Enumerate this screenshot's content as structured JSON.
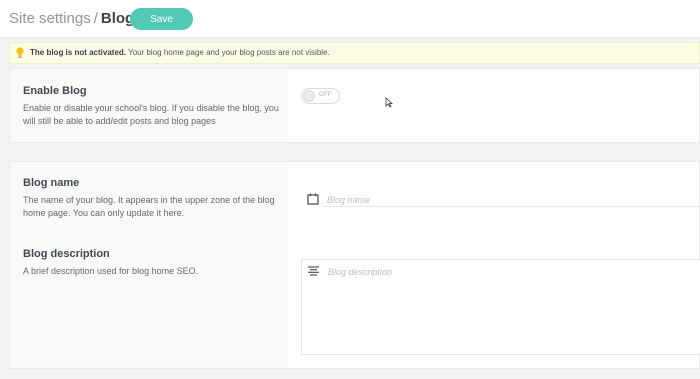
{
  "header": {
    "breadcrumb_parent": "Site settings",
    "separator": "/",
    "breadcrumb_current": "Blog",
    "save_label": "Save"
  },
  "alert": {
    "strong_text": "The blog is not activated.",
    "text": " Your blog home page and your blog posts are not visible.",
    "icon": "lightbulb-icon"
  },
  "enable_blog": {
    "title": "Enable Blog",
    "description": "Enable or disable your school's blog. If you disable the blog, you will still be able to add/edit posts and blog pages",
    "toggle_state": "OFF",
    "enabled": false
  },
  "blog_name": {
    "title": "Blog name",
    "description": "The name of your blog. It appears in the upper zone of the blog home page. You can only update it here.",
    "placeholder": "Blog name",
    "value": "",
    "icon": "calendar-icon"
  },
  "blog_description": {
    "title": "Blog description",
    "description": "A brief description used for blog home SEO.",
    "placeholder": "Blog description",
    "value": "",
    "icon": "lines-icon"
  },
  "colors": {
    "accent": "#52c9b5",
    "alert_bg": "#fcfce6",
    "bulb": "#f4c21b"
  }
}
